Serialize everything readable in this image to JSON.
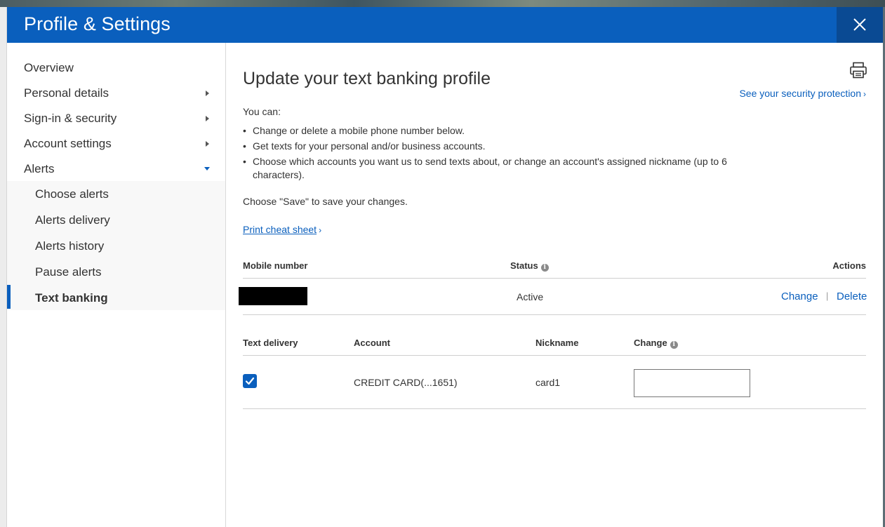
{
  "modal": {
    "title": "Profile & Settings",
    "close_icon": "close-icon"
  },
  "sidebar": {
    "items": [
      {
        "label": "Overview",
        "indicator": "none"
      },
      {
        "label": "Personal details",
        "indicator": "arrow-right"
      },
      {
        "label": "Sign-in & security",
        "indicator": "arrow-right"
      },
      {
        "label": "Account settings",
        "indicator": "arrow-right"
      },
      {
        "label": "Alerts",
        "indicator": "arrow-down",
        "expanded": true
      }
    ],
    "subitems": [
      {
        "label": "Choose alerts"
      },
      {
        "label": "Alerts delivery"
      },
      {
        "label": "Alerts history"
      },
      {
        "label": "Pause alerts"
      },
      {
        "label": "Text banking",
        "active": true
      }
    ]
  },
  "main": {
    "title": "Update your text banking profile",
    "print_icon": "printer-icon",
    "security_link": "See your security protection",
    "intro": "You can:",
    "bullets": [
      "Change or delete a mobile phone number below.",
      "Get texts for your personal and/or business accounts.",
      "Choose which accounts you want us to send texts about, or change an account's assigned nickname (up to 6 characters)."
    ],
    "save_note": "Choose \"Save\" to save your changes.",
    "cheat_sheet_link": "Print cheat sheet",
    "phone_table": {
      "headers": {
        "mobile": "Mobile number",
        "status": "Status",
        "actions": "Actions"
      },
      "row": {
        "status": "Active",
        "change": "Change",
        "separator": "|",
        "delete": "Delete"
      }
    },
    "accounts_table": {
      "headers": {
        "delivery": "Text delivery",
        "account": "Account",
        "nickname": "Nickname",
        "change": "Change"
      },
      "row": {
        "checked": true,
        "account": "CREDIT CARD(...1651)",
        "nickname": "card1",
        "change_value": ""
      }
    }
  },
  "colors": {
    "brand": "#0a5fbd",
    "header_dark": "#0a4a93",
    "text": "#333333"
  }
}
